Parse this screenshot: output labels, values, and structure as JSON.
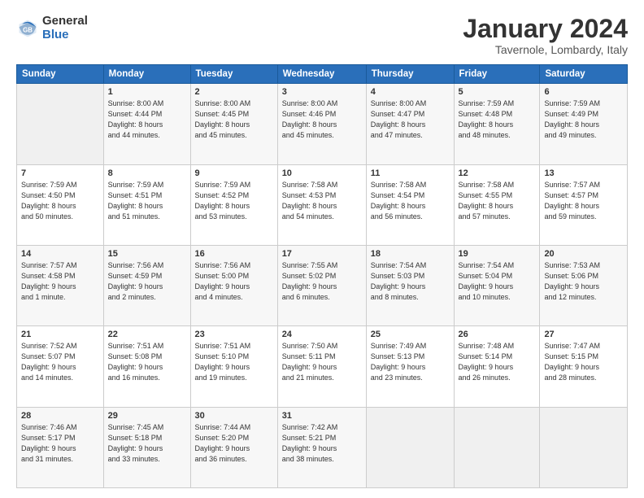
{
  "header": {
    "logo_general": "General",
    "logo_blue": "Blue",
    "title": "January 2024",
    "subtitle": "Tavernole, Lombardy, Italy"
  },
  "days_of_week": [
    "Sunday",
    "Monday",
    "Tuesday",
    "Wednesday",
    "Thursday",
    "Friday",
    "Saturday"
  ],
  "weeks": [
    [
      {
        "num": "",
        "info": ""
      },
      {
        "num": "1",
        "info": "Sunrise: 8:00 AM\nSunset: 4:44 PM\nDaylight: 8 hours\nand 44 minutes."
      },
      {
        "num": "2",
        "info": "Sunrise: 8:00 AM\nSunset: 4:45 PM\nDaylight: 8 hours\nand 45 minutes."
      },
      {
        "num": "3",
        "info": "Sunrise: 8:00 AM\nSunset: 4:46 PM\nDaylight: 8 hours\nand 45 minutes."
      },
      {
        "num": "4",
        "info": "Sunrise: 8:00 AM\nSunset: 4:47 PM\nDaylight: 8 hours\nand 47 minutes."
      },
      {
        "num": "5",
        "info": "Sunrise: 7:59 AM\nSunset: 4:48 PM\nDaylight: 8 hours\nand 48 minutes."
      },
      {
        "num": "6",
        "info": "Sunrise: 7:59 AM\nSunset: 4:49 PM\nDaylight: 8 hours\nand 49 minutes."
      }
    ],
    [
      {
        "num": "7",
        "info": "Sunrise: 7:59 AM\nSunset: 4:50 PM\nDaylight: 8 hours\nand 50 minutes."
      },
      {
        "num": "8",
        "info": "Sunrise: 7:59 AM\nSunset: 4:51 PM\nDaylight: 8 hours\nand 51 minutes."
      },
      {
        "num": "9",
        "info": "Sunrise: 7:59 AM\nSunset: 4:52 PM\nDaylight: 8 hours\nand 53 minutes."
      },
      {
        "num": "10",
        "info": "Sunrise: 7:58 AM\nSunset: 4:53 PM\nDaylight: 8 hours\nand 54 minutes."
      },
      {
        "num": "11",
        "info": "Sunrise: 7:58 AM\nSunset: 4:54 PM\nDaylight: 8 hours\nand 56 minutes."
      },
      {
        "num": "12",
        "info": "Sunrise: 7:58 AM\nSunset: 4:55 PM\nDaylight: 8 hours\nand 57 minutes."
      },
      {
        "num": "13",
        "info": "Sunrise: 7:57 AM\nSunset: 4:57 PM\nDaylight: 8 hours\nand 59 minutes."
      }
    ],
    [
      {
        "num": "14",
        "info": "Sunrise: 7:57 AM\nSunset: 4:58 PM\nDaylight: 9 hours\nand 1 minute."
      },
      {
        "num": "15",
        "info": "Sunrise: 7:56 AM\nSunset: 4:59 PM\nDaylight: 9 hours\nand 2 minutes."
      },
      {
        "num": "16",
        "info": "Sunrise: 7:56 AM\nSunset: 5:00 PM\nDaylight: 9 hours\nand 4 minutes."
      },
      {
        "num": "17",
        "info": "Sunrise: 7:55 AM\nSunset: 5:02 PM\nDaylight: 9 hours\nand 6 minutes."
      },
      {
        "num": "18",
        "info": "Sunrise: 7:54 AM\nSunset: 5:03 PM\nDaylight: 9 hours\nand 8 minutes."
      },
      {
        "num": "19",
        "info": "Sunrise: 7:54 AM\nSunset: 5:04 PM\nDaylight: 9 hours\nand 10 minutes."
      },
      {
        "num": "20",
        "info": "Sunrise: 7:53 AM\nSunset: 5:06 PM\nDaylight: 9 hours\nand 12 minutes."
      }
    ],
    [
      {
        "num": "21",
        "info": "Sunrise: 7:52 AM\nSunset: 5:07 PM\nDaylight: 9 hours\nand 14 minutes."
      },
      {
        "num": "22",
        "info": "Sunrise: 7:51 AM\nSunset: 5:08 PM\nDaylight: 9 hours\nand 16 minutes."
      },
      {
        "num": "23",
        "info": "Sunrise: 7:51 AM\nSunset: 5:10 PM\nDaylight: 9 hours\nand 19 minutes."
      },
      {
        "num": "24",
        "info": "Sunrise: 7:50 AM\nSunset: 5:11 PM\nDaylight: 9 hours\nand 21 minutes."
      },
      {
        "num": "25",
        "info": "Sunrise: 7:49 AM\nSunset: 5:13 PM\nDaylight: 9 hours\nand 23 minutes."
      },
      {
        "num": "26",
        "info": "Sunrise: 7:48 AM\nSunset: 5:14 PM\nDaylight: 9 hours\nand 26 minutes."
      },
      {
        "num": "27",
        "info": "Sunrise: 7:47 AM\nSunset: 5:15 PM\nDaylight: 9 hours\nand 28 minutes."
      }
    ],
    [
      {
        "num": "28",
        "info": "Sunrise: 7:46 AM\nSunset: 5:17 PM\nDaylight: 9 hours\nand 31 minutes."
      },
      {
        "num": "29",
        "info": "Sunrise: 7:45 AM\nSunset: 5:18 PM\nDaylight: 9 hours\nand 33 minutes."
      },
      {
        "num": "30",
        "info": "Sunrise: 7:44 AM\nSunset: 5:20 PM\nDaylight: 9 hours\nand 36 minutes."
      },
      {
        "num": "31",
        "info": "Sunrise: 7:42 AM\nSunset: 5:21 PM\nDaylight: 9 hours\nand 38 minutes."
      },
      {
        "num": "",
        "info": ""
      },
      {
        "num": "",
        "info": ""
      },
      {
        "num": "",
        "info": ""
      }
    ]
  ]
}
